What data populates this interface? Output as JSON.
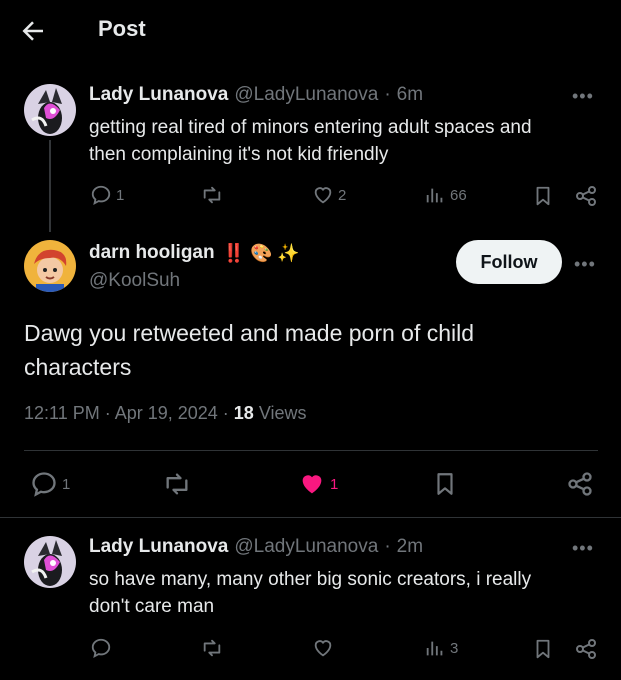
{
  "header": {
    "title": "Post"
  },
  "tweet1": {
    "name": "Lady Lunanova",
    "handle": "@LadyLunanova",
    "time": "6m",
    "text_line1": "getting real tired of minors entering adult spaces and",
    "text_line2": "then complaining it's not kid friendly",
    "replies": "1",
    "likes": "2",
    "views": "66"
  },
  "main": {
    "name": "darn hooligan",
    "emoji": "‼️ 🎨 ✨",
    "handle": "@KoolSuh",
    "follow_label": "Follow",
    "text_line1": "Dawg you retweeted and made porn of child",
    "text_line2": "characters",
    "timestamp": "12:11 PM · Apr 19, 2024 · ",
    "views_count": "18",
    "views_label": " Views",
    "replies": "1",
    "likes": "1"
  },
  "tweet3": {
    "name": "Lady Lunanova",
    "handle": "@LadyLunanova",
    "time": "2m",
    "text_line1": "so have many, many other big sonic creators, i really",
    "text_line2": "don't care man",
    "views": "3"
  },
  "icons": {
    "back": "arrow-left-icon",
    "more": "more-dots-icon",
    "reply": "reply-icon",
    "retweet": "retweet-icon",
    "like": "heart-icon",
    "views": "views-icon",
    "bookmark": "bookmark-icon",
    "share": "share-icon"
  },
  "colors": {
    "like_active": "#f91880",
    "follow_bg": "#eff3f4"
  }
}
